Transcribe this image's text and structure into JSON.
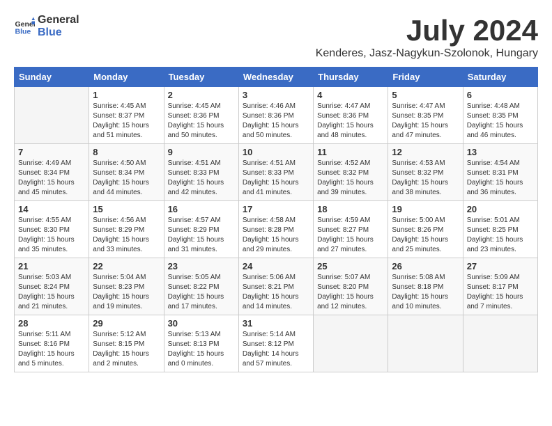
{
  "logo": {
    "general": "General",
    "blue": "Blue"
  },
  "title": "July 2024",
  "location": "Kenderes, Jasz-Nagykun-Szolonok, Hungary",
  "headers": [
    "Sunday",
    "Monday",
    "Tuesday",
    "Wednesday",
    "Thursday",
    "Friday",
    "Saturday"
  ],
  "weeks": [
    [
      {
        "day": "",
        "info": ""
      },
      {
        "day": "1",
        "info": "Sunrise: 4:45 AM\nSunset: 8:37 PM\nDaylight: 15 hours\nand 51 minutes."
      },
      {
        "day": "2",
        "info": "Sunrise: 4:45 AM\nSunset: 8:36 PM\nDaylight: 15 hours\nand 50 minutes."
      },
      {
        "day": "3",
        "info": "Sunrise: 4:46 AM\nSunset: 8:36 PM\nDaylight: 15 hours\nand 50 minutes."
      },
      {
        "day": "4",
        "info": "Sunrise: 4:47 AM\nSunset: 8:36 PM\nDaylight: 15 hours\nand 48 minutes."
      },
      {
        "day": "5",
        "info": "Sunrise: 4:47 AM\nSunset: 8:35 PM\nDaylight: 15 hours\nand 47 minutes."
      },
      {
        "day": "6",
        "info": "Sunrise: 4:48 AM\nSunset: 8:35 PM\nDaylight: 15 hours\nand 46 minutes."
      }
    ],
    [
      {
        "day": "7",
        "info": "Sunrise: 4:49 AM\nSunset: 8:34 PM\nDaylight: 15 hours\nand 45 minutes."
      },
      {
        "day": "8",
        "info": "Sunrise: 4:50 AM\nSunset: 8:34 PM\nDaylight: 15 hours\nand 44 minutes."
      },
      {
        "day": "9",
        "info": "Sunrise: 4:51 AM\nSunset: 8:33 PM\nDaylight: 15 hours\nand 42 minutes."
      },
      {
        "day": "10",
        "info": "Sunrise: 4:51 AM\nSunset: 8:33 PM\nDaylight: 15 hours\nand 41 minutes."
      },
      {
        "day": "11",
        "info": "Sunrise: 4:52 AM\nSunset: 8:32 PM\nDaylight: 15 hours\nand 39 minutes."
      },
      {
        "day": "12",
        "info": "Sunrise: 4:53 AM\nSunset: 8:32 PM\nDaylight: 15 hours\nand 38 minutes."
      },
      {
        "day": "13",
        "info": "Sunrise: 4:54 AM\nSunset: 8:31 PM\nDaylight: 15 hours\nand 36 minutes."
      }
    ],
    [
      {
        "day": "14",
        "info": "Sunrise: 4:55 AM\nSunset: 8:30 PM\nDaylight: 15 hours\nand 35 minutes."
      },
      {
        "day": "15",
        "info": "Sunrise: 4:56 AM\nSunset: 8:29 PM\nDaylight: 15 hours\nand 33 minutes."
      },
      {
        "day": "16",
        "info": "Sunrise: 4:57 AM\nSunset: 8:29 PM\nDaylight: 15 hours\nand 31 minutes."
      },
      {
        "day": "17",
        "info": "Sunrise: 4:58 AM\nSunset: 8:28 PM\nDaylight: 15 hours\nand 29 minutes."
      },
      {
        "day": "18",
        "info": "Sunrise: 4:59 AM\nSunset: 8:27 PM\nDaylight: 15 hours\nand 27 minutes."
      },
      {
        "day": "19",
        "info": "Sunrise: 5:00 AM\nSunset: 8:26 PM\nDaylight: 15 hours\nand 25 minutes."
      },
      {
        "day": "20",
        "info": "Sunrise: 5:01 AM\nSunset: 8:25 PM\nDaylight: 15 hours\nand 23 minutes."
      }
    ],
    [
      {
        "day": "21",
        "info": "Sunrise: 5:03 AM\nSunset: 8:24 PM\nDaylight: 15 hours\nand 21 minutes."
      },
      {
        "day": "22",
        "info": "Sunrise: 5:04 AM\nSunset: 8:23 PM\nDaylight: 15 hours\nand 19 minutes."
      },
      {
        "day": "23",
        "info": "Sunrise: 5:05 AM\nSunset: 8:22 PM\nDaylight: 15 hours\nand 17 minutes."
      },
      {
        "day": "24",
        "info": "Sunrise: 5:06 AM\nSunset: 8:21 PM\nDaylight: 15 hours\nand 14 minutes."
      },
      {
        "day": "25",
        "info": "Sunrise: 5:07 AM\nSunset: 8:20 PM\nDaylight: 15 hours\nand 12 minutes."
      },
      {
        "day": "26",
        "info": "Sunrise: 5:08 AM\nSunset: 8:18 PM\nDaylight: 15 hours\nand 10 minutes."
      },
      {
        "day": "27",
        "info": "Sunrise: 5:09 AM\nSunset: 8:17 PM\nDaylight: 15 hours\nand 7 minutes."
      }
    ],
    [
      {
        "day": "28",
        "info": "Sunrise: 5:11 AM\nSunset: 8:16 PM\nDaylight: 15 hours\nand 5 minutes."
      },
      {
        "day": "29",
        "info": "Sunrise: 5:12 AM\nSunset: 8:15 PM\nDaylight: 15 hours\nand 2 minutes."
      },
      {
        "day": "30",
        "info": "Sunrise: 5:13 AM\nSunset: 8:13 PM\nDaylight: 15 hours\nand 0 minutes."
      },
      {
        "day": "31",
        "info": "Sunrise: 5:14 AM\nSunset: 8:12 PM\nDaylight: 14 hours\nand 57 minutes."
      },
      {
        "day": "",
        "info": ""
      },
      {
        "day": "",
        "info": ""
      },
      {
        "day": "",
        "info": ""
      }
    ]
  ]
}
